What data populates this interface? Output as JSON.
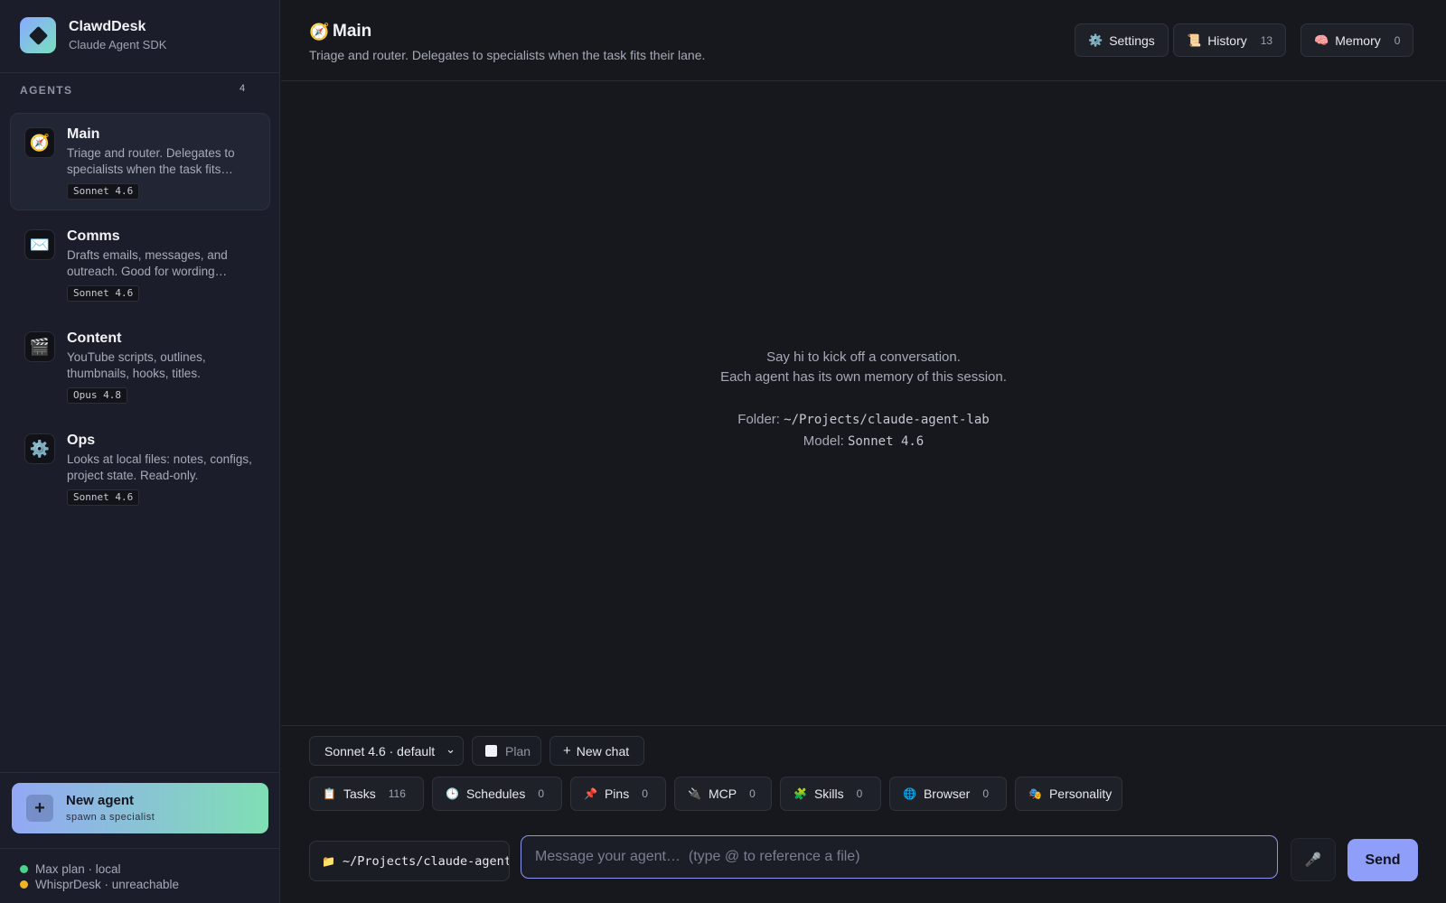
{
  "brand": {
    "name": "ClawdDesk",
    "subtitle": "Claude Agent SDK",
    "logo_icon": "diamond-logo"
  },
  "sidebar": {
    "section_label": "AGENTS",
    "agent_count": "4",
    "agents": [
      {
        "name": "Main",
        "description": "Triage and router. Delegates to specialists when the task fits…",
        "model": "Sonnet 4.6",
        "icon": "compass-icon",
        "glyph": "🧭",
        "active": true
      },
      {
        "name": "Comms",
        "description": "Drafts emails, messages, and outreach. Good for wording…",
        "model": "Sonnet 4.6",
        "icon": "envelope-icon",
        "glyph": "✉️",
        "active": false
      },
      {
        "name": "Content",
        "description": "YouTube scripts, outlines, thumbnails, hooks, titles.",
        "model": "Opus 4.8",
        "icon": "clapperboard-icon",
        "glyph": "🎬",
        "active": false
      },
      {
        "name": "Ops",
        "description": "Looks at local files: notes, configs, project state. Read-only.",
        "model": "Sonnet 4.6",
        "icon": "gear-icon",
        "glyph": "⚙️",
        "active": false
      }
    ],
    "new_agent": {
      "title": "New agent",
      "subtitle": "spawn a specialist",
      "icon": "plus-icon",
      "glyph": "+"
    },
    "status": [
      {
        "text": "Max plan · local",
        "color": "#4ad38b"
      },
      {
        "text": "WhisprDesk · unreachable",
        "color": "#f0b429"
      }
    ]
  },
  "header": {
    "icon": "🧭",
    "title": "Main",
    "subtitle": "Triage and router. Delegates to specialists when the task fits their lane.",
    "settings": {
      "label": "Settings",
      "icon": "⚙️"
    },
    "history": {
      "label": "History",
      "count": "13",
      "icon": "📜"
    },
    "memory": {
      "label": "Memory",
      "count": "0",
      "icon": "🧠"
    }
  },
  "empty_state": {
    "line1": "Say hi to kick off a conversation.",
    "line2": "Each agent has its own memory of this session.",
    "folder_label": "Folder:",
    "folder_value": "~/Projects/claude-agent-lab",
    "model_label": "Model:",
    "model_value": "Sonnet 4.6"
  },
  "controls": {
    "model_select": "Sonnet 4.6 · default",
    "plan_label": "Plan",
    "new_chat_label": "New chat"
  },
  "tools": [
    {
      "label": "Tasks",
      "count": "116",
      "icon": "clipboard-icon",
      "glyph": "📋"
    },
    {
      "label": "Schedules",
      "count": "0",
      "icon": "clock-icon",
      "glyph": "🕒"
    },
    {
      "label": "Pins",
      "count": "0",
      "icon": "pin-icon",
      "glyph": "📌"
    },
    {
      "label": "MCP",
      "count": "0",
      "icon": "plug-icon",
      "glyph": "🔌"
    },
    {
      "label": "Skills",
      "count": "0",
      "icon": "puzzle-icon",
      "glyph": "🧩"
    },
    {
      "label": "Browser",
      "count": "0",
      "icon": "globe-icon",
      "glyph": "🌐"
    },
    {
      "label": "Personality",
      "count": "",
      "icon": "masks-icon",
      "glyph": "🎭"
    }
  ],
  "composer": {
    "folder_path": "~/Projects/claude-agent",
    "folder_icon": "📁",
    "placeholder": "Message your agent…  (type @ to reference a file)",
    "mic_icon": "🎤",
    "send_label": "Send"
  },
  "colors": {
    "accent": "#8f9ef9",
    "accent_green": "#7fdfb4",
    "background": "#17181d",
    "sidebar": "#1b1e2a"
  }
}
